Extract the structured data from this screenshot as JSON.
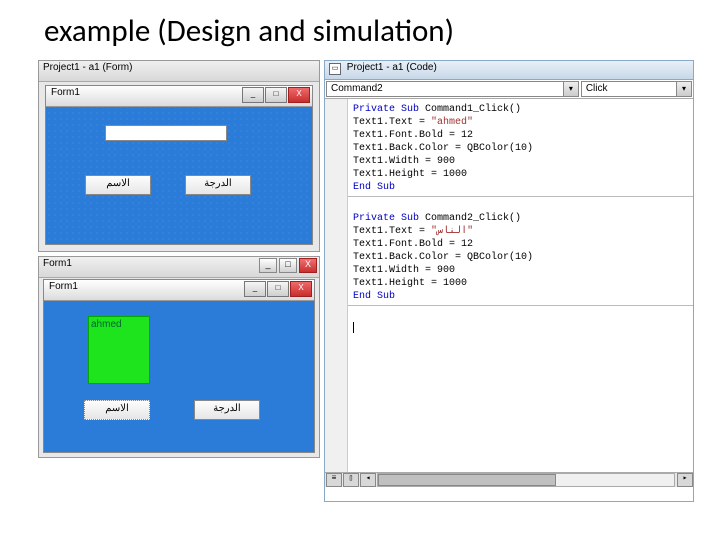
{
  "slide": {
    "title": "example (Design and simulation)"
  },
  "design_outer1": {
    "title": "Project1 - a1 (Form)"
  },
  "form1_design": {
    "title": "Form1",
    "button1": "الاسم",
    "button2": "الدرجة"
  },
  "design_outer2": {
    "title": "Form1"
  },
  "form1_run": {
    "title": "Form1",
    "result_text": "ahmed",
    "button1": "الاسم",
    "button2": "الدرجة"
  },
  "code_window": {
    "title": "Project1 - a1 (Code)",
    "combo_object": "Command2",
    "combo_event": "Click",
    "lines1": {
      "l1a": "Private Sub",
      "l1b": " Command1_Click()",
      "l2": "Text1.Text = ",
      "l2s": "\"ahmed\"",
      "l3": "Text1.Font.Bold = 12",
      "l4": "Text1.Back.Color = QBColor(10)",
      "l5": "Text1.Width = 900",
      "l6": "Text1.Height = 1000",
      "l7": "End Sub"
    },
    "lines2": {
      "l1a": "Private Sub",
      "l1b": " Command2_Click()",
      "l2": "Text1.Text = ",
      "l2s": "\"الناس\"",
      "l3": "Text1.Font.Bold = 12",
      "l4": "Text1.Back.Color = QBColor(10)",
      "l5": "Text1.Width = 900",
      "l6": "Text1.Height = 1000",
      "l7": "End Sub"
    }
  }
}
